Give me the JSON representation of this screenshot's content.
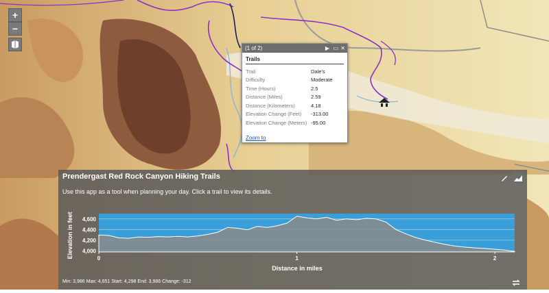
{
  "map_controls": {
    "zoom_in": "+",
    "zoom_out": "−",
    "basemap_toggle_icon": "basemap-icon"
  },
  "popup": {
    "counter": "(1 of 2)",
    "title": "Trails",
    "rows": [
      {
        "label": "Trail",
        "value": "Dale's"
      },
      {
        "label": "Difficulty",
        "value": "Moderate"
      },
      {
        "label": "Time (Hours)",
        "value": "2.5"
      },
      {
        "label": "Distance (Miles)",
        "value": "2.59"
      },
      {
        "label": "Distance (Kilometers)",
        "value": "4.18"
      },
      {
        "label": "Elevation Change (Feet)",
        "value": "-313.00"
      },
      {
        "label": "Elevation Change (Meters)",
        "value": "-95.00"
      }
    ],
    "zoom_to": "Zoom to"
  },
  "panel": {
    "title": "Prendergast Red Rock Canyon Hiking Trails",
    "subtitle": "Use this app as a tool when planning your day. Click a trail to view its details.",
    "stats": "Min: 3,986 Max: 4,651 Start: 4,298 End: 3,986 Change: -312"
  },
  "chart_data": {
    "type": "area",
    "xlabel": "Distance in miles",
    "ylabel": "Elevation in feet",
    "xlim": [
      0,
      2.1
    ],
    "ylim": [
      3980,
      4700
    ],
    "x_ticks": [
      "0",
      "1",
      "2"
    ],
    "y_ticks": [
      "4,000",
      "4,200",
      "4,400",
      "4,600"
    ],
    "x": [
      0,
      0.05,
      0.1,
      0.15,
      0.2,
      0.25,
      0.3,
      0.35,
      0.4,
      0.45,
      0.5,
      0.55,
      0.6,
      0.65,
      0.7,
      0.75,
      0.8,
      0.85,
      0.9,
      0.95,
      1.0,
      1.05,
      1.1,
      1.15,
      1.2,
      1.25,
      1.3,
      1.35,
      1.4,
      1.45,
      1.5,
      1.55,
      1.6,
      1.65,
      1.7,
      1.75,
      1.8,
      1.85,
      1.9,
      1.95,
      2.0,
      2.05,
      2.1
    ],
    "values": [
      4298,
      4290,
      4245,
      4235,
      4260,
      4255,
      4268,
      4262,
      4272,
      4262,
      4280,
      4310,
      4350,
      4440,
      4425,
      4395,
      4460,
      4440,
      4470,
      4520,
      4650,
      4620,
      4600,
      4630,
      4575,
      4600,
      4585,
      4610,
      4600,
      4540,
      4400,
      4320,
      4250,
      4200,
      4160,
      4120,
      4090,
      4070,
      4055,
      4045,
      4030,
      4015,
      3986
    ]
  }
}
